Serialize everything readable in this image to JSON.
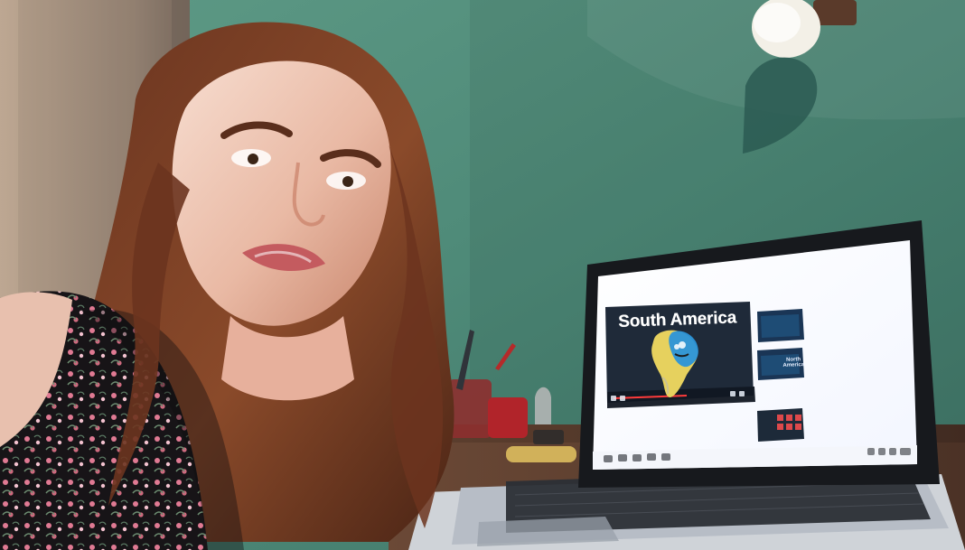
{
  "laptop_screen": {
    "video_title": "South America",
    "thumbnail_label": "North America"
  },
  "palette": {
    "wall": "#4f8a79",
    "door": "#a89580",
    "screen": "#ffffff",
    "video_bg": "#1f2a39",
    "map_yellow": "#e6d15e",
    "map_blue": "#2b94d9",
    "desk": "#5a3c2b"
  }
}
